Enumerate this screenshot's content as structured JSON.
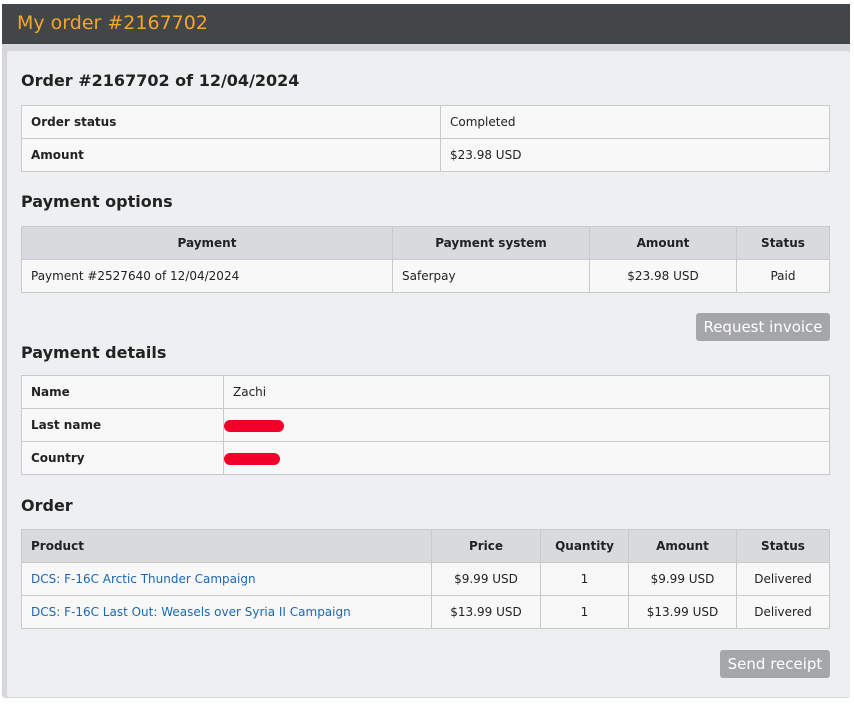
{
  "header": {
    "title": "My order #2167702"
  },
  "order_summary": {
    "title": "Order #2167702 of 12/04/2024",
    "rows": [
      {
        "label": "Order status",
        "value": "Completed"
      },
      {
        "label": "Amount",
        "value": "$23.98 USD"
      }
    ]
  },
  "payment_options": {
    "title": "Payment options",
    "columns": [
      "Payment",
      "Payment system",
      "Amount",
      "Status"
    ],
    "rows": [
      {
        "payment": "Payment #2527640 of 12/04/2024",
        "system": "Saferpay",
        "amount": "$23.98 USD",
        "status": "Paid"
      }
    ],
    "button": "Request invoice"
  },
  "payment_details": {
    "title": "Payment details",
    "rows": [
      {
        "label": "Name",
        "value": "Zachi"
      },
      {
        "label": "Last name",
        "value": ""
      },
      {
        "label": "Country",
        "value": ""
      }
    ]
  },
  "order": {
    "title": "Order",
    "columns": [
      "Product",
      "Price",
      "Quantity",
      "Amount",
      "Status"
    ],
    "rows": [
      {
        "product": "DCS: F-16C Arctic Thunder Campaign",
        "price": "$9.99 USD",
        "quantity": "1",
        "amount": "$9.99 USD",
        "status": "Delivered"
      },
      {
        "product": "DCS: F-16C Last Out: Weasels over Syria II Campaign",
        "price": "$13.99 USD",
        "quantity": "1",
        "amount": "$13.99 USD",
        "status": "Delivered"
      }
    ],
    "button": "Send receipt"
  },
  "colors": {
    "header_bg": "#434649",
    "header_text": "#f4a62a",
    "link": "#1b67b3",
    "button_bg": "#a5a6a8",
    "redaction": "#f00028"
  }
}
